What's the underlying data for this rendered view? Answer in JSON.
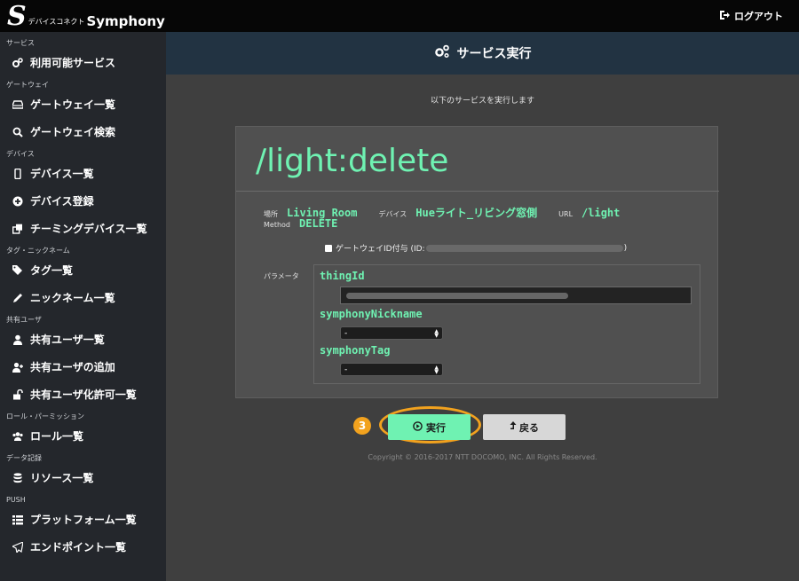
{
  "app": {
    "logo_mark": "S",
    "logo_small": "デバイスコネクト",
    "logo_big": "Symphony",
    "logout_label": "ログアウト"
  },
  "sidebar": {
    "sections": [
      {
        "title": "サービス",
        "items": [
          {
            "label": "利用可能サービス",
            "icon": "cogs-icon"
          }
        ]
      },
      {
        "title": "ゲートウェイ",
        "items": [
          {
            "label": "ゲートウェイ一覧",
            "icon": "hdd-icon"
          },
          {
            "label": "ゲートウェイ検索",
            "icon": "search-icon"
          }
        ]
      },
      {
        "title": "デバイス",
        "items": [
          {
            "label": "デバイス一覧",
            "icon": "mobile-icon"
          },
          {
            "label": "デバイス登録",
            "icon": "plus-circle-icon"
          },
          {
            "label": "チーミングデバイス一覧",
            "icon": "clone-icon"
          }
        ]
      },
      {
        "title": "タグ・ニックネーム",
        "items": [
          {
            "label": "タグ一覧",
            "icon": "tags-icon"
          },
          {
            "label": "ニックネーム一覧",
            "icon": "pencil-icon"
          }
        ]
      },
      {
        "title": "共有ユーザ",
        "items": [
          {
            "label": "共有ユーザ一覧",
            "icon": "user-icon"
          },
          {
            "label": "共有ユーザの追加",
            "icon": "user-plus-icon"
          },
          {
            "label": "共有ユーザ化許可一覧",
            "icon": "unlock-icon"
          }
        ]
      },
      {
        "title": "ロール・パーミッション",
        "items": [
          {
            "label": "ロール一覧",
            "icon": "users-icon"
          }
        ]
      },
      {
        "title": "データ記録",
        "items": [
          {
            "label": "リソース一覧",
            "icon": "database-icon"
          }
        ]
      },
      {
        "title": "PUSH",
        "items": [
          {
            "label": "プラットフォーム一覧",
            "icon": "list-icon"
          },
          {
            "label": "エンドポイント一覧",
            "icon": "send-icon"
          }
        ]
      }
    ]
  },
  "main": {
    "header_title": "サービス実行",
    "intro": "以下のサービスを実行します",
    "service_path": "/light:delete",
    "meta": {
      "place_label": "場所",
      "place_value": "Living Room",
      "device_label": "デバイス",
      "device_value": "Hueライト_リビング窓側",
      "url_label": "URL",
      "url_value": "/light",
      "method_label": "Method",
      "method_value": "DELETE"
    },
    "checkbox": {
      "label_prefix": "ゲートウェイID付与 (ID:",
      "label_suffix": ")",
      "checked": false
    },
    "params_label": "パラメータ",
    "params": [
      {
        "name": "thingId",
        "type": "text"
      },
      {
        "name": "symphonyNickname",
        "type": "select",
        "selected": "-"
      },
      {
        "name": "symphonyTag",
        "type": "select",
        "selected": "-"
      }
    ],
    "step_number": "3",
    "execute_label": "実行",
    "back_label": "戻る",
    "copyright": "Copyright © 2016-2017 NTT DOCOMO, INC. All Rights Reserved."
  },
  "colors": {
    "accent": "#6ff2b2",
    "highlight": "#f2a21e",
    "header_bg": "#223342",
    "sidebar_bg": "#24272c"
  }
}
